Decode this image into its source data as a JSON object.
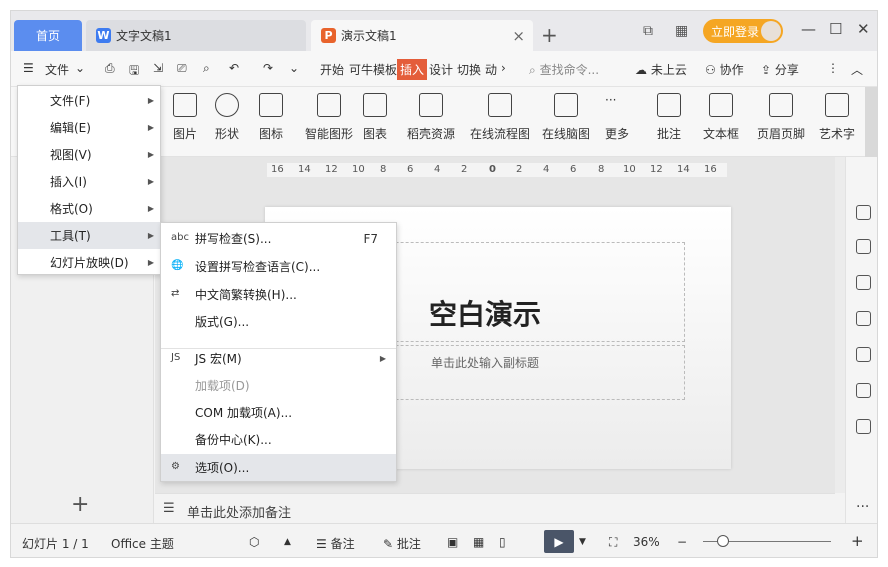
{
  "tabs": {
    "home": "首页",
    "doc_title": "文字文稿1",
    "doc_icon": "W",
    "ppt_title": "演示文稿1",
    "ppt_icon": "P",
    "close": "×",
    "add": "+"
  },
  "titlebar": {
    "login": "立即登录",
    "minimize": "—",
    "maximize": "☐",
    "close": "✕"
  },
  "ribbon_tabs": {
    "file_menu": "文件",
    "items": [
      "开始",
      "可牛模板",
      "插入",
      "设计",
      "切换",
      "动"
    ],
    "active": "插入",
    "search_placeholder": "查找命令...",
    "cloud": "未上云",
    "collaborate": "协作",
    "share": "分享"
  },
  "ribbon": {
    "buttons": [
      "图片",
      "形状",
      "图标",
      "智能图形",
      "图表",
      "稻壳资源",
      "在线流程图",
      "在线脑图",
      "更多",
      "批注",
      "文本框",
      "页眉页脚",
      "艺术字"
    ]
  },
  "ruler": {
    "ticks": [
      "16",
      "14",
      "12",
      "10",
      "8",
      "6",
      "4",
      "2",
      "0",
      "2",
      "4",
      "6",
      "8",
      "10",
      "12",
      "14",
      "16"
    ]
  },
  "slide": {
    "title": "空白演示",
    "subtitle": "单击此处输入副标题"
  },
  "notes": {
    "placeholder": "单击此处添加备注"
  },
  "main_menu": {
    "items": [
      "文件(F)",
      "编辑(E)",
      "视图(V)",
      "插入(I)",
      "格式(O)",
      "工具(T)",
      "幻灯片放映(D)"
    ],
    "selected": "工具(T)"
  },
  "tools_menu": {
    "items": [
      {
        "label": "拼写检查(S)...",
        "shortcut": "F7"
      },
      {
        "label": "设置拼写检查语言(C)..."
      },
      {
        "label": "中文简繁转换(H)..."
      },
      {
        "label": "版式(G)..."
      },
      {
        "label": "JS 宏(M)"
      },
      {
        "label": "加载项(D)"
      },
      {
        "label": "COM 加载项(A)..."
      },
      {
        "label": "备份中心(K)..."
      },
      {
        "label": "选项(O)..."
      }
    ],
    "disabled": "加载项(D)",
    "hovered": "选项(O)..."
  },
  "status_bar": {
    "slide_count": "幻灯片 1 / 1",
    "theme": "Office 主题",
    "notes_btn": "备注",
    "comment_btn": "批注",
    "zoom": "36%",
    "zoom_minus": "−",
    "zoom_plus": "+"
  }
}
